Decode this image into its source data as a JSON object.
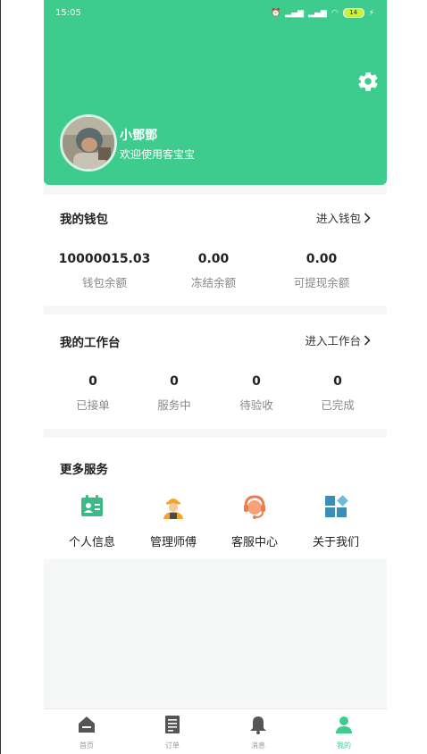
{
  "status_bar": {
    "time": "15:05",
    "battery": "14"
  },
  "header": {
    "user_name": "小鄧鄧",
    "welcome": "欢迎使用客宝宝"
  },
  "wallet": {
    "title": "我的钱包",
    "link": "进入钱包",
    "stats": [
      {
        "value": "10000015.03",
        "label": "钱包余额"
      },
      {
        "value": "0.00",
        "label": "冻结余额"
      },
      {
        "value": "0.00",
        "label": "可提现余额"
      }
    ]
  },
  "workbench": {
    "title": "我的工作台",
    "link": "进入工作台",
    "stats": [
      {
        "value": "0",
        "label": "已接单"
      },
      {
        "value": "0",
        "label": "服务中"
      },
      {
        "value": "0",
        "label": "待验收"
      },
      {
        "value": "0",
        "label": "已完成"
      }
    ]
  },
  "services": {
    "title": "更多服务",
    "items": [
      {
        "label": "个人信息",
        "icon": "id-card-icon"
      },
      {
        "label": "管理师傅",
        "icon": "worker-icon"
      },
      {
        "label": "客服中心",
        "icon": "headset-icon"
      },
      {
        "label": "关于我们",
        "icon": "grid-icon"
      }
    ]
  },
  "tabbar": {
    "items": [
      {
        "label": "首页",
        "icon": "home-icon"
      },
      {
        "label": "订单",
        "icon": "order-icon"
      },
      {
        "label": "消息",
        "icon": "bell-icon"
      },
      {
        "label": "我的",
        "icon": "user-icon",
        "active": true
      }
    ]
  },
  "colors": {
    "brand": "#3dcc8e"
  }
}
